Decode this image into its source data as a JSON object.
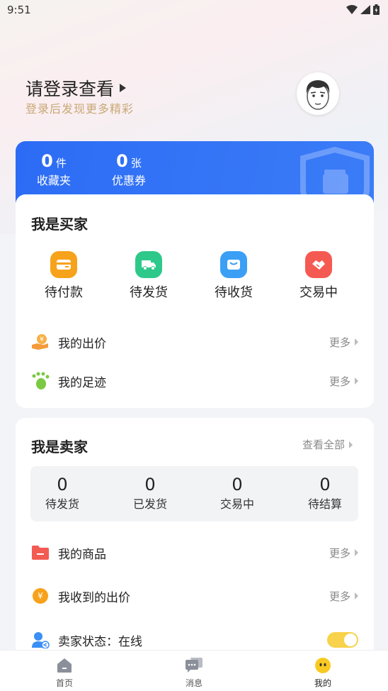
{
  "status": {
    "time": "9:51"
  },
  "login": {
    "title": "请登录查看",
    "subtitle": "登录后发现更多精彩"
  },
  "wallet": {
    "favorites": {
      "count": "0",
      "unit": "件",
      "label": "收藏夹"
    },
    "coupons": {
      "count": "0",
      "unit": "张",
      "label": "优惠券"
    }
  },
  "buyer": {
    "title": "我是买家",
    "orders": [
      {
        "label": "待付款",
        "icon": "wallet-icon",
        "color": "#f7a21b"
      },
      {
        "label": "待发货",
        "icon": "truck-icon",
        "color": "#2ec98a"
      },
      {
        "label": "待收货",
        "icon": "box-icon",
        "color": "#3b9ff5"
      },
      {
        "label": "交易中",
        "icon": "handshake-icon",
        "color": "#f55a52"
      }
    ],
    "rows": [
      {
        "label": "我的出价",
        "more": "更多",
        "icon": "bid-hand-icon"
      },
      {
        "label": "我的足迹",
        "more": "更多",
        "icon": "footprint-icon"
      }
    ]
  },
  "seller": {
    "title": "我是卖家",
    "view_all": "查看全部",
    "stats": [
      {
        "value": "0",
        "label": "待发货"
      },
      {
        "value": "0",
        "label": "已发货"
      },
      {
        "value": "0",
        "label": "交易中"
      },
      {
        "value": "0",
        "label": "待结算"
      }
    ],
    "rows": [
      {
        "label": "我的商品",
        "more": "更多",
        "icon": "folder-icon"
      },
      {
        "label": "我收到的出价",
        "more": "更多",
        "icon": "yen-coin-icon"
      },
      {
        "label": "卖家状态：在线",
        "icon": "user-status-icon",
        "toggle_on": true
      }
    ]
  },
  "tabs": [
    {
      "label": "首页",
      "icon": "home-icon"
    },
    {
      "label": "消息",
      "icon": "message-icon"
    },
    {
      "label": "我的",
      "icon": "profile-face-icon"
    }
  ],
  "colors": {
    "accent_blue": "#2c6cf5",
    "gold": "#c8a875",
    "toggle": "#f8d24a"
  }
}
